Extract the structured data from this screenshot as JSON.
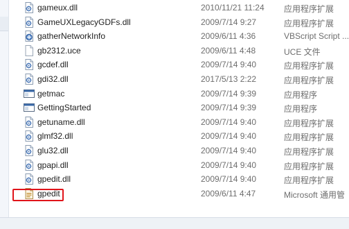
{
  "files": [
    {
      "name": "gameux.dll",
      "date": "2010/11/21 11:24",
      "type": "应用程序扩展",
      "icon": "dll-icon"
    },
    {
      "name": "GameUXLegacyGDFs.dll",
      "date": "2009/7/14 9:27",
      "type": "应用程序扩展",
      "icon": "dll-icon"
    },
    {
      "name": "gatherNetworkInfo",
      "date": "2009/6/11 4:36",
      "type": "VBScript Script ...",
      "icon": "vbscript-icon"
    },
    {
      "name": "gb2312.uce",
      "date": "2009/6/11 4:48",
      "type": "UCE 文件",
      "icon": "blank-file-icon"
    },
    {
      "name": "gcdef.dll",
      "date": "2009/7/14 9:40",
      "type": "应用程序扩展",
      "icon": "dll-icon"
    },
    {
      "name": "gdi32.dll",
      "date": "2017/5/13 2:22",
      "type": "应用程序扩展",
      "icon": "dll-icon"
    },
    {
      "name": "getmac",
      "date": "2009/7/14 9:39",
      "type": "应用程序",
      "icon": "exe-icon"
    },
    {
      "name": "GettingStarted",
      "date": "2009/7/14 9:39",
      "type": "应用程序",
      "icon": "exe-icon"
    },
    {
      "name": "getuname.dll",
      "date": "2009/7/14 9:40",
      "type": "应用程序扩展",
      "icon": "dll-icon"
    },
    {
      "name": "glmf32.dll",
      "date": "2009/7/14 9:40",
      "type": "应用程序扩展",
      "icon": "dll-icon"
    },
    {
      "name": "glu32.dll",
      "date": "2009/7/14 9:40",
      "type": "应用程序扩展",
      "icon": "dll-icon"
    },
    {
      "name": "gpapi.dll",
      "date": "2009/7/14 9:40",
      "type": "应用程序扩展",
      "icon": "dll-icon"
    },
    {
      "name": "gpedit.dll",
      "date": "2009/7/14 9:40",
      "type": "应用程序扩展",
      "icon": "dll-icon"
    },
    {
      "name": "gpedit",
      "date": "2009/6/11 4:47",
      "type": "Microsoft 通用管",
      "icon": "msc-icon"
    }
  ],
  "colors": {
    "highlight": "#e0141a",
    "text": "#1e1e1e",
    "meta_text": "#6d6d6d"
  }
}
